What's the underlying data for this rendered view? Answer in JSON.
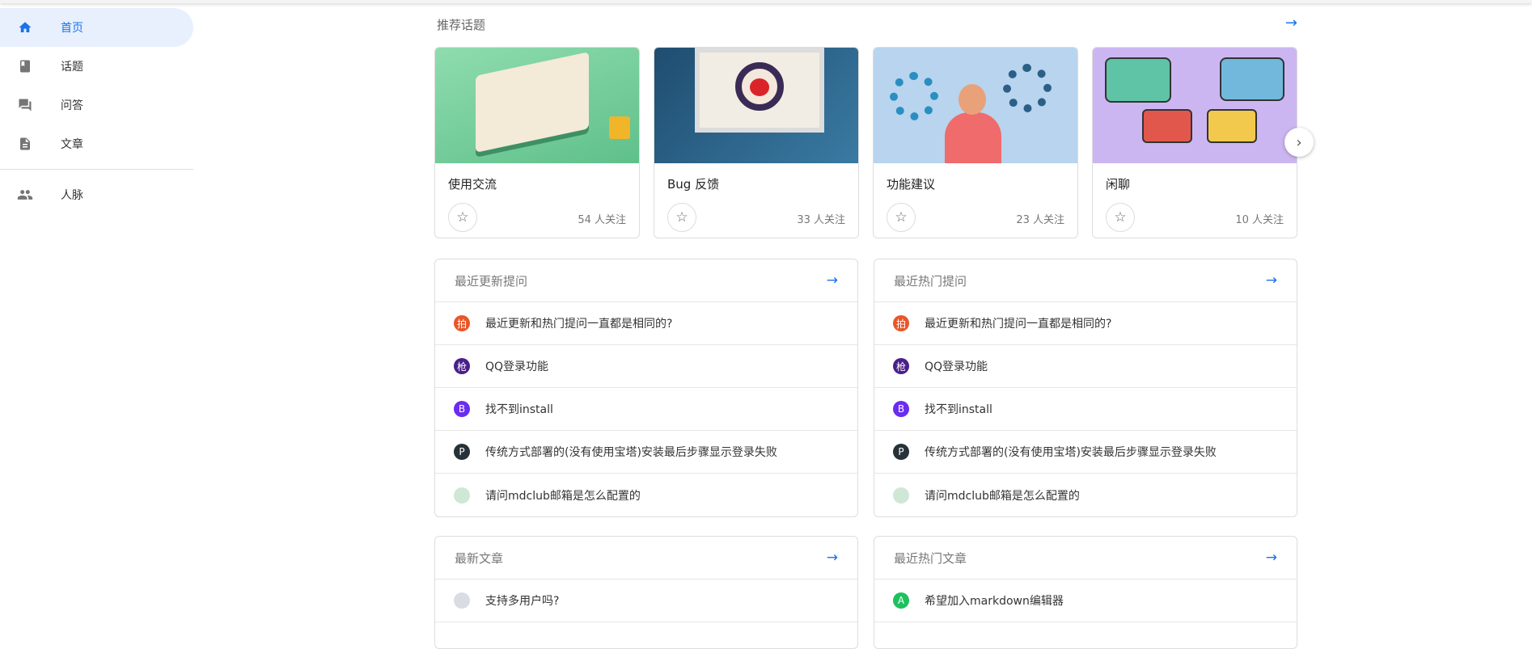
{
  "sidebar": {
    "items": [
      {
        "label": "首页",
        "icon": "home-icon",
        "active": true
      },
      {
        "label": "话题",
        "icon": "book-icon"
      },
      {
        "label": "问答",
        "icon": "forum-icon"
      },
      {
        "label": "文章",
        "icon": "description-icon"
      },
      {
        "label": "人脉",
        "icon": "people-icon"
      }
    ]
  },
  "topics": {
    "title": "推荐话题",
    "cards": [
      {
        "title": "使用交流",
        "followers": "54 人关注",
        "color": "#7fd3a2"
      },
      {
        "title": "Bug 反馈",
        "followers": "33 人关注",
        "color": "#2a5a80"
      },
      {
        "title": "功能建议",
        "followers": "23 人关注",
        "color": "#b8d4ee"
      },
      {
        "title": "闲聊",
        "followers": "10 人关注",
        "color": "#ccb6f2"
      }
    ]
  },
  "panels": {
    "recent_questions": {
      "title": "最近更新提问",
      "rows": [
        {
          "avatar": "拍",
          "color": "#e8562a",
          "text": "最近更新和热门提问一直都是相同的?"
        },
        {
          "avatar": "枪",
          "color": "#4a1f8a",
          "text": "QQ登录功能"
        },
        {
          "avatar": "B",
          "color": "#6a2cf0",
          "text": "找不到install"
        },
        {
          "avatar": "P",
          "color": "#263238",
          "text": "传统方式部署的(没有使用宝塔)安装最后步骤显示登录失败"
        },
        {
          "avatar": "",
          "color": "#cfe8d6",
          "text": "请问mdclub邮箱是怎么配置的"
        }
      ]
    },
    "hot_questions": {
      "title": "最近热门提问",
      "rows": [
        {
          "avatar": "拍",
          "color": "#e8562a",
          "text": "最近更新和热门提问一直都是相同的?"
        },
        {
          "avatar": "枪",
          "color": "#4a1f8a",
          "text": "QQ登录功能"
        },
        {
          "avatar": "B",
          "color": "#6a2cf0",
          "text": "找不到install"
        },
        {
          "avatar": "P",
          "color": "#263238",
          "text": "传统方式部署的(没有使用宝塔)安装最后步骤显示登录失败"
        },
        {
          "avatar": "",
          "color": "#cfe8d6",
          "text": "请问mdclub邮箱是怎么配置的"
        }
      ]
    },
    "latest_articles": {
      "title": "最新文章",
      "rows": [
        {
          "avatar": "",
          "color": "#d9dde3",
          "text": "支持多用户吗?"
        }
      ]
    },
    "hot_articles": {
      "title": "最近热门文章",
      "rows": [
        {
          "avatar": "A",
          "color": "#1ec15e",
          "text": "希望加入markdown编辑器"
        }
      ]
    }
  }
}
